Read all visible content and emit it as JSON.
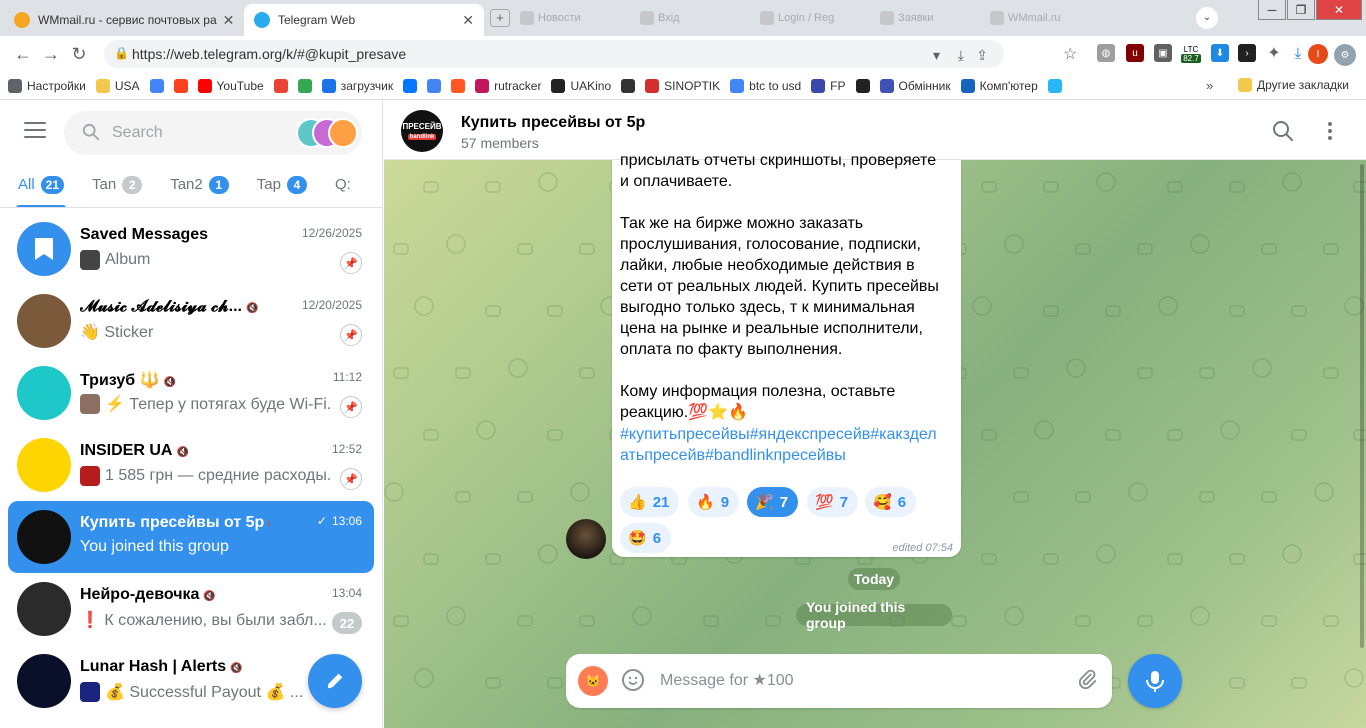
{
  "browser": {
    "tabs": [
      {
        "title": "WMmail.ru - сервис почтовых ра",
        "active": false
      },
      {
        "title": "Telegram Web",
        "active": true
      }
    ],
    "ghost_tabs": [
      "Новости",
      "Вхід",
      "Login / Reg",
      "Заявки",
      "WMmail.ru"
    ],
    "url": "https://web.telegram.org/k/#@kupit_presave",
    "ltc_label": "LTC",
    "ltc_value": "82.7",
    "profile_initial": "I",
    "bookmarks": [
      {
        "label": "Настройки",
        "icon": "gear-icon",
        "color": "#5f6368"
      },
      {
        "label": "USA",
        "icon": "folder-icon",
        "color": "#f2c94c"
      },
      {
        "label": "",
        "icon": "google-icon",
        "color": "#4285f4"
      },
      {
        "label": "",
        "icon": "yandex-icon",
        "color": "#fc3f1d"
      },
      {
        "label": "YouTube",
        "icon": "youtube-icon",
        "color": "#ff0000"
      },
      {
        "label": "",
        "icon": "gmail-icon",
        "color": "#ea4335"
      },
      {
        "label": "",
        "icon": "drive-icon",
        "color": "#34a853"
      },
      {
        "label": "загрузчик",
        "icon": "infinity-icon",
        "color": "#1a73e8"
      },
      {
        "label": "",
        "icon": "vk-icon",
        "color": "#0077ff"
      },
      {
        "label": "",
        "icon": "translate-icon",
        "color": "#4285f4"
      },
      {
        "label": "",
        "icon": "f-icon",
        "color": "#ff5722"
      },
      {
        "label": "rutracker",
        "icon": "rutracker-icon",
        "color": "#c2185b"
      },
      {
        "label": "UAKino",
        "icon": "uakino-icon",
        "color": "#222222"
      },
      {
        "label": "",
        "icon": "figure-icon",
        "color": "#333333"
      },
      {
        "label": "SINOPTIK",
        "icon": "thermometer-icon",
        "color": "#d32f2f"
      },
      {
        "label": "btc to usd",
        "icon": "google-icon",
        "color": "#4285f4"
      },
      {
        "label": "FP",
        "icon": "fp-icon",
        "color": "#3949ab"
      },
      {
        "label": "",
        "icon": "bc-icon",
        "color": "#222222"
      },
      {
        "label": "Обмінник",
        "icon": "diamond-icon",
        "color": "#3f51b5"
      },
      {
        "label": "Комп'ютер",
        "icon": "globe-icon",
        "color": "#1565c0"
      },
      {
        "label": "",
        "icon": "star-icon",
        "color": "#29b6f6"
      }
    ],
    "bookmarks_more": "»",
    "other_bookmarks": "Другие закладки"
  },
  "sidebar": {
    "search_placeholder": "Search",
    "folders": [
      {
        "label": "All",
        "count": "21",
        "active": true
      },
      {
        "label": "Tan",
        "count": "2",
        "active": false
      },
      {
        "label": "Tan2",
        "count": "1",
        "active": false
      },
      {
        "label": "Tap",
        "count": "4",
        "active": false
      },
      {
        "label": "Q:",
        "count": "",
        "active": false
      }
    ],
    "chats": [
      {
        "title": "Saved Messages",
        "time": "12/26/2025",
        "message": "Album",
        "muted": false,
        "pinned": true,
        "unread": "",
        "selected": false,
        "avatar": "#3390ec"
      },
      {
        "title": "𝓜𝓾𝓼𝓲𝓬 𝓐𝓭𝓮𝓵𝓲𝓼𝓲𝔂𝓪 𝓬𝓱...",
        "time": "12/20/2025",
        "message": "👋 Sticker",
        "muted": true,
        "pinned": true,
        "unread": "",
        "selected": false,
        "avatar": "#7a5a3a"
      },
      {
        "title": "Тризуб 🔱",
        "time": "11:12",
        "message": "⚡ Тепер у потягах буде Wi-Fi...",
        "muted": true,
        "pinned": true,
        "unread": "",
        "selected": false,
        "avatar": "#1ec8c8"
      },
      {
        "title": "INSIDER UA",
        "time": "12:52",
        "message": "1 585 грн — средние расходы...",
        "muted": true,
        "pinned": true,
        "unread": "",
        "selected": false,
        "avatar": "#ffd500"
      },
      {
        "title": "Купить пресейвы от 5р",
        "time": "13:06",
        "message": "You joined this group",
        "muted": true,
        "pinned": false,
        "unread": "",
        "selected": true,
        "avatar": "#111111"
      },
      {
        "title": "Нейро-девочка",
        "time": "13:04",
        "message": "❗ К сожалению, вы были забл...",
        "muted": true,
        "pinned": false,
        "unread": "22",
        "selected": false,
        "avatar": "#2b2b2b"
      },
      {
        "title": "Lunar Hash | Alerts",
        "time": "",
        "message": "💰 Successful Payout 💰 ...",
        "muted": true,
        "pinned": false,
        "unread": "",
        "selected": false,
        "avatar": "#0a0f2a"
      }
    ]
  },
  "chat": {
    "title": "Купить пресейвы от 5р",
    "subtitle": "57 members",
    "avatar_text_top": "ПРЕСЕЙВ",
    "avatar_text_bottom": "bandlink",
    "message_lines": [
      "присылать отчеты скриншоты, проверяете",
      "и оплачиваете.",
      "",
      "Так же на бирже можно заказать",
      "прослушивания, голосование, подписки,",
      "лайки, любые необходимые действия в",
      "сети от реальных людей. Купить пресейвы",
      "выгодно только здесь, т к минимальная",
      "цена на рынке и реальные исполнители,",
      "оплата по факту выполнения.",
      "",
      "Кому информация полезна, оставьте",
      "реакцию.💯⭐🔥"
    ],
    "hashtag_lines": [
      "#купитьпресейвы#яндекспресейв#какздел",
      "атьпресейв#bandlinkпресейвы"
    ],
    "reactions": [
      {
        "emoji": "👍",
        "count": "21",
        "mine": false
      },
      {
        "emoji": "🔥",
        "count": "9",
        "mine": false
      },
      {
        "emoji": "🎉",
        "count": "7",
        "mine": true
      },
      {
        "emoji": "💯",
        "count": "7",
        "mine": false
      },
      {
        "emoji": "🥰",
        "count": "6",
        "mine": false
      },
      {
        "emoji": "🤩",
        "count": "6",
        "mine": false
      }
    ],
    "edited_label": "edited",
    "edited_time": "07:54",
    "date_label": "Today",
    "service_message": "You joined this group",
    "composer_placeholder": "Message for ★100"
  },
  "colors": {
    "accent": "#3390ec"
  }
}
